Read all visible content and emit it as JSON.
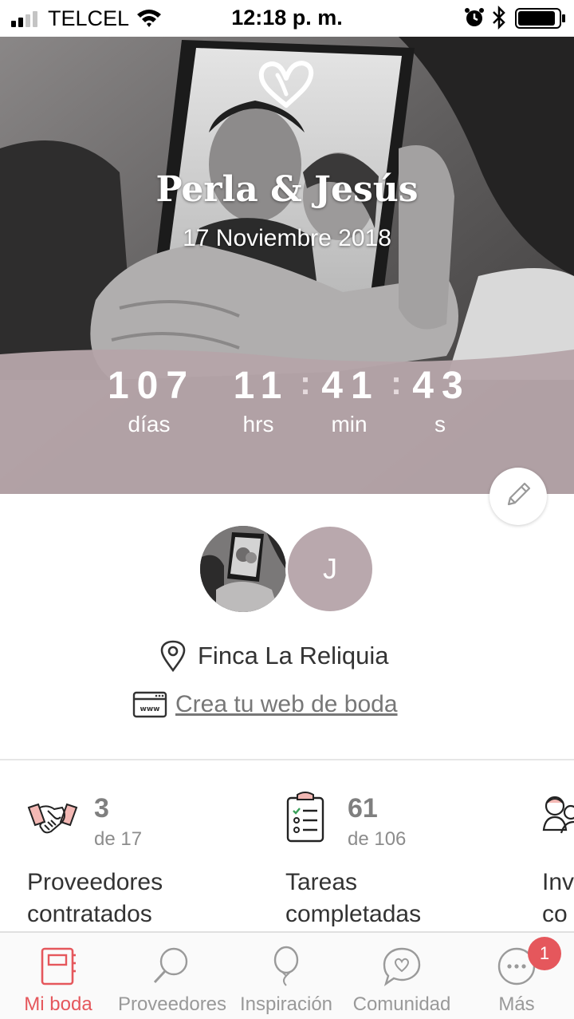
{
  "status_bar": {
    "carrier": "TELCEL",
    "time": "12:18 p. m."
  },
  "hero": {
    "names": "Perla & Jesús",
    "date": "17 Noviembre 2018"
  },
  "countdown": {
    "days": "107",
    "hours": "11",
    "minutes": "41",
    "seconds": "43",
    "days_label": "días",
    "hours_label": "hrs",
    "minutes_label": "min",
    "seconds_label": "s",
    "separator": ":"
  },
  "profile": {
    "partner_initial": "J",
    "venue": "Finca La Reliquia",
    "web_link": "Crea tu web de boda"
  },
  "stats": [
    {
      "value": "3",
      "of": "de 17",
      "title_line1": "Proveedores",
      "title_line2": "contratados",
      "icon": "handshake-icon"
    },
    {
      "value": "61",
      "of": "de 106",
      "title_line1": "Tareas",
      "title_line2": "completadas",
      "icon": "checklist-icon"
    },
    {
      "value": "",
      "of": "",
      "title_line1": "Inv",
      "title_line2": "co",
      "icon": "guests-icon"
    }
  ],
  "tabs": [
    {
      "label": "Mi boda",
      "icon": "notebook-icon",
      "active": true
    },
    {
      "label": "Proveedores",
      "icon": "magnifier-icon",
      "active": false
    },
    {
      "label": "Inspiración",
      "icon": "balloon-icon",
      "active": false
    },
    {
      "label": "Comunidad",
      "icon": "chat-heart-icon",
      "active": false
    },
    {
      "label": "Más",
      "icon": "more-icon",
      "active": false
    }
  ],
  "more_badge": "1",
  "colors": {
    "accent": "#e5575c",
    "countdown_band": "#b5a4a9",
    "avatar_bg": "#b9a8ad"
  }
}
